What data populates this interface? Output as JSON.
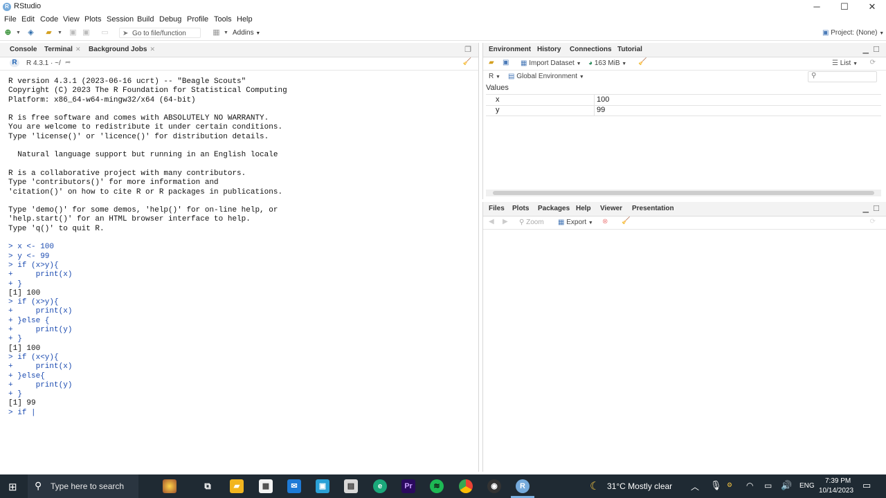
{
  "window": {
    "title": "RStudio"
  },
  "menus": [
    "File",
    "Edit",
    "Code",
    "View",
    "Plots",
    "Session",
    "Build",
    "Debug",
    "Profile",
    "Tools",
    "Help"
  ],
  "toolbar": {
    "goto_placeholder": "Go to file/function",
    "addins_label": "Addins",
    "project_label": "Project: (None)"
  },
  "left_pane": {
    "tabs": [
      {
        "label": "Console"
      },
      {
        "label": "Terminal"
      },
      {
        "label": "Background Jobs"
      }
    ],
    "version_label": "R 4.3.1 · ~/",
    "console_lines": [
      "R version 4.3.1 (2023-06-16 ucrt) -- \"Beagle Scouts\"",
      "Copyright (C) 2023 The R Foundation for Statistical Computing",
      "Platform: x86_64-w64-mingw32/x64 (64-bit)",
      "",
      "R is free software and comes with ABSOLUTELY NO WARRANTY.",
      "You are welcome to redistribute it under certain conditions.",
      "Type 'license()' or 'licence()' for distribution details.",
      "",
      "  Natural language support but running in an English locale",
      "",
      "R is a collaborative project with many contributors.",
      "Type 'contributors()' for more information and",
      "'citation()' on how to cite R or R packages in publications.",
      "",
      "Type 'demo()' for some demos, 'help()' for on-line help, or",
      "'help.start()' for an HTML browser interface to help.",
      "Type 'q()' to quit R.",
      "",
      "> x <- 100",
      "> y <- 99",
      "> if (x>y){",
      "+     print(x)",
      "+ }",
      "[1] 100",
      "> if (x>y){",
      "+     print(x)",
      "+ }else {",
      "+     print(y)",
      "+ }",
      "[1] 100",
      "> if (x<y){",
      "+     print(x)",
      "+ }else{",
      "+     print(y)",
      "+ }",
      "[1] 99",
      "> if |"
    ]
  },
  "env_pane": {
    "tabs": [
      {
        "label": "Environment"
      },
      {
        "label": "History"
      },
      {
        "label": "Connections"
      },
      {
        "label": "Tutorial"
      }
    ],
    "import_label": "Import Dataset",
    "memory_label": "163 MiB",
    "list_label": "List",
    "r_label": "R",
    "scope_label": "Global Environment",
    "section_label": "Values",
    "rows": [
      {
        "name": "x",
        "value": "100"
      },
      {
        "name": "y",
        "value": "99"
      }
    ]
  },
  "files_pane": {
    "tabs": [
      {
        "label": "Files"
      },
      {
        "label": "Plots"
      },
      {
        "label": "Packages"
      },
      {
        "label": "Help"
      },
      {
        "label": "Viewer"
      },
      {
        "label": "Presentation"
      }
    ],
    "zoom_label": "Zoom",
    "export_label": "Export"
  },
  "taskbar": {
    "search_placeholder": "Type here to search",
    "weather": "31°C  Mostly clear",
    "lang": "ENG",
    "time": "7:39 PM",
    "date": "10/14/2023"
  }
}
